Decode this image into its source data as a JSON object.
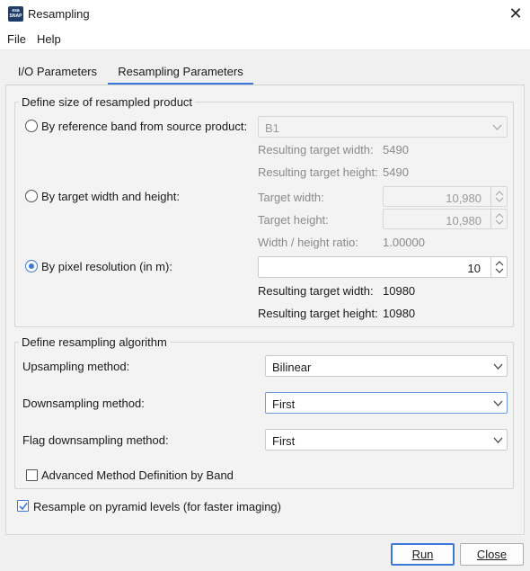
{
  "window": {
    "title": "Resampling",
    "icon_text": "esa SNAP"
  },
  "menu": {
    "items": [
      "File",
      "Help"
    ]
  },
  "tabs": [
    {
      "label": "I/O Parameters",
      "active": false
    },
    {
      "label": "Resampling Parameters",
      "active": true
    }
  ],
  "size_group": {
    "title": "Define size of resampled product",
    "ref_band": {
      "label": "By reference band from source product:",
      "selected": false,
      "value": "B1",
      "width_label": "Resulting target width:",
      "width_value": "5490",
      "height_label": "Resulting target height:",
      "height_value": "5490"
    },
    "target_wh": {
      "label": "By target width and height:",
      "selected": false,
      "width_label": "Target width:",
      "width_value": "10,980",
      "height_label": "Target height:",
      "height_value": "10,980",
      "ratio_label": "Width / height ratio:",
      "ratio_value": "1.00000"
    },
    "pixel_res": {
      "label": "By pixel resolution (in m):",
      "selected": true,
      "value": "10",
      "width_label": "Resulting target width:",
      "width_value": "10980",
      "height_label": "Resulting target height:",
      "height_value": "10980"
    }
  },
  "algo_group": {
    "title": "Define resampling algorithm",
    "upsampling": {
      "label": "Upsampling method:",
      "value": "Bilinear"
    },
    "downsampling": {
      "label": "Downsampling method:",
      "value": "First"
    },
    "flag_downsampling": {
      "label": "Flag downsampling method:",
      "value": "First"
    },
    "advanced": {
      "label": "Advanced Method Definition by Band",
      "checked": false
    }
  },
  "pyramid": {
    "label": "Resample on pyramid levels (for faster imaging)",
    "checked": true
  },
  "buttons": {
    "run": "Run",
    "close": "Close"
  },
  "colors": {
    "accent": "#3c78d8",
    "background": "#f0f0f0"
  }
}
